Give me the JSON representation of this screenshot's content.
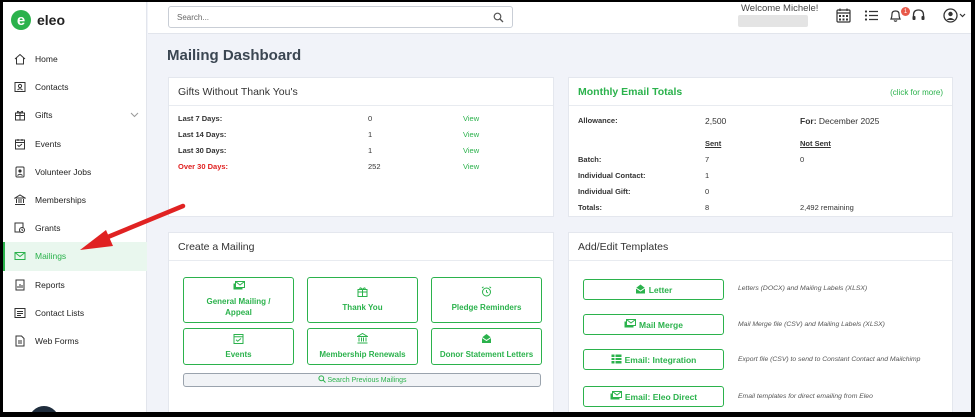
{
  "brand": {
    "logo_letter": "e",
    "name": "eleo",
    "accent": "#2bb24c"
  },
  "sidebar": {
    "items": [
      {
        "label": "Home",
        "icon": "home-icon"
      },
      {
        "label": "Contacts",
        "icon": "contacts-icon"
      },
      {
        "label": "Gifts",
        "icon": "gift-icon"
      },
      {
        "label": "Events",
        "icon": "calendar-icon"
      },
      {
        "label": "Volunteer Jobs",
        "icon": "volunteer-icon"
      },
      {
        "label": "Memberships",
        "icon": "bank-icon"
      },
      {
        "label": "Grants",
        "icon": "grants-icon"
      },
      {
        "label": "Mailings",
        "icon": "mail-icon",
        "active": true
      },
      {
        "label": "Reports",
        "icon": "reports-icon"
      },
      {
        "label": "Contact Lists",
        "icon": "list-icon"
      },
      {
        "label": "Web Forms",
        "icon": "form-icon"
      }
    ]
  },
  "topbar": {
    "search_placeholder": "Search...",
    "welcome": "Welcome Michele!",
    "notification_count": "1"
  },
  "page": {
    "title": "Mailing Dashboard"
  },
  "gifts_card": {
    "title": "Gifts Without Thank You's",
    "rows": [
      {
        "label": "Last 7 Days:",
        "value": "0",
        "link": "View"
      },
      {
        "label": "Last 14 Days:",
        "value": "1",
        "link": "View"
      },
      {
        "label": "Last 30 Days:",
        "value": "1",
        "link": "View"
      },
      {
        "label": "Over 30 Days:",
        "value": "252",
        "link": "View"
      }
    ]
  },
  "email_card": {
    "title": "Monthly Email Totals",
    "more": "(click for more)",
    "allowance_label": "Allowance:",
    "allowance_value": "2,500",
    "for_label": "For:",
    "for_value": "December 2025",
    "sent_header": "Sent",
    "not_sent_header": "Not Sent",
    "rows": [
      {
        "label": "Batch:",
        "sent": "7",
        "not_sent": "0"
      },
      {
        "label": "Individual Contact:",
        "sent": "1",
        "not_sent": ""
      },
      {
        "label": "Individual Gift:",
        "sent": "0",
        "not_sent": ""
      },
      {
        "label": "Totals:",
        "sent": "8",
        "not_sent": "2,492 remaining"
      }
    ]
  },
  "create_card": {
    "title": "Create a Mailing",
    "buttons": [
      {
        "label": "General Mailing / Appeal",
        "icon": "mail-stack-icon"
      },
      {
        "label": "Thank You",
        "icon": "gift-icon"
      },
      {
        "label": "Pledge Reminders",
        "icon": "alarm-icon"
      },
      {
        "label": "Events",
        "icon": "calendar-check-icon"
      },
      {
        "label": "Membership Renewals",
        "icon": "bank-icon"
      },
      {
        "label": "Donor Statement Letters",
        "icon": "envelope-open-icon"
      }
    ],
    "search_previous": "Search Previous Mailings"
  },
  "templates_card": {
    "title": "Add/Edit Templates",
    "items": [
      {
        "label": "Letter",
        "desc": "Letters (DOCX) and Mailing Labels (XLSX)"
      },
      {
        "label": "Mail Merge",
        "desc": "Mail Merge file (CSV) and Mailing Labels (XLSX)"
      },
      {
        "label": "Email: Integration",
        "desc": "Export file (CSV) to send to Constant Contact and Mailchimp"
      },
      {
        "label": "Email: Eleo Direct",
        "desc": "Email templates for direct emailing from Eleo"
      }
    ]
  }
}
